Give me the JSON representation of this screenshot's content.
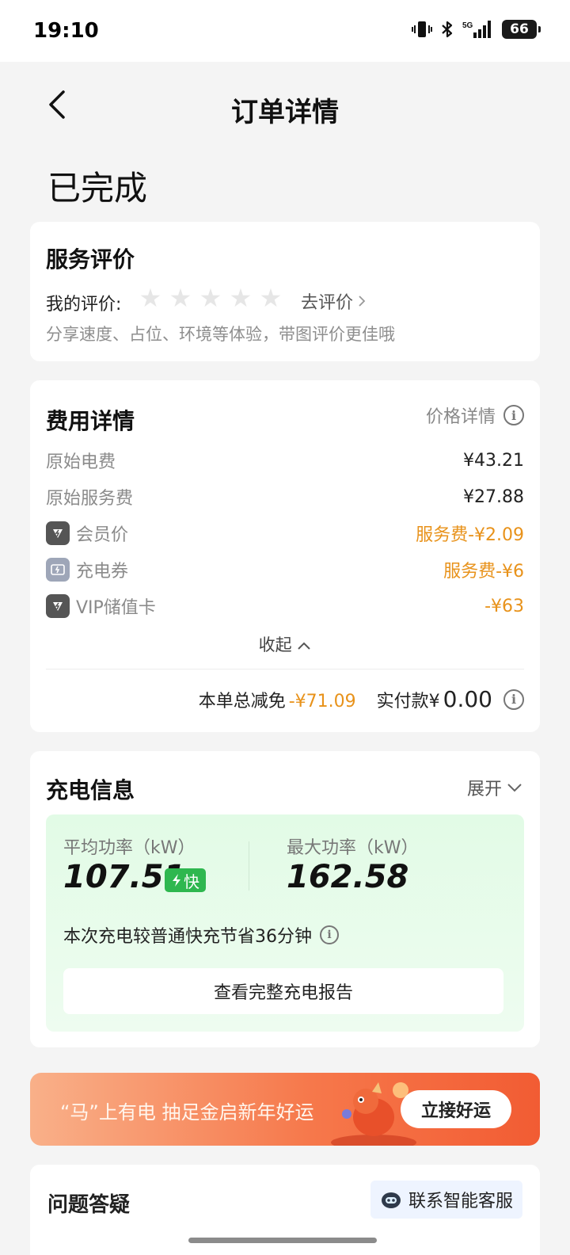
{
  "status_bar": {
    "time": "19:10",
    "battery": "66",
    "network": "5G",
    "icons": [
      "vibrate-icon",
      "bluetooth-icon",
      "signal-5g-icon",
      "battery-icon"
    ]
  },
  "nav": {
    "title": "订单详情",
    "back_icon": "chevron-left-icon"
  },
  "order_status": "已完成",
  "review": {
    "title": "服务评价",
    "label": "我的评价:",
    "rating": 0,
    "max_rating": 5,
    "go_review": "去评价",
    "hint": "分享速度、占位、环境等体验，带图评价更佳哦"
  },
  "fee": {
    "title": "费用详情",
    "price_detail": "价格详情",
    "rows": [
      {
        "label": "原始电费",
        "value": "¥43.21"
      },
      {
        "label": "原始服务费",
        "value": "¥27.88"
      },
      {
        "label": "会员价",
        "value": "服务费-¥2.09",
        "icon": "member-bolt-icon"
      },
      {
        "label": "充电券",
        "value": "服务费-¥6",
        "icon": "coupon-icon"
      },
      {
        "label": "VIP储值卡",
        "value": "-¥63",
        "icon": "vip-card-icon"
      }
    ],
    "collapse": "收起",
    "total_label": "本单总减免",
    "total_discount": "-¥71.09",
    "paid_label": "实付款¥",
    "paid_amount": "0.00",
    "colors": {
      "discount": "#e8921a"
    }
  },
  "charge": {
    "title": "充电信息",
    "expand": "展开",
    "avg_label": "平均功率（kW）",
    "avg_value": "107.51",
    "fast_badge": "快",
    "max_label": "最大功率（kW）",
    "max_value": "162.58",
    "saving": "本次充电较普通快充节省36分钟",
    "report_button": "查看完整充电报告",
    "colors": {
      "badge": "#2eb74f",
      "box": "#e2fbe6"
    }
  },
  "promo": {
    "text": "“马”上有电 抽足金启新年好运",
    "button": "立接好运"
  },
  "qa": {
    "title": "问题答疑",
    "service": "联系智能客服"
  }
}
